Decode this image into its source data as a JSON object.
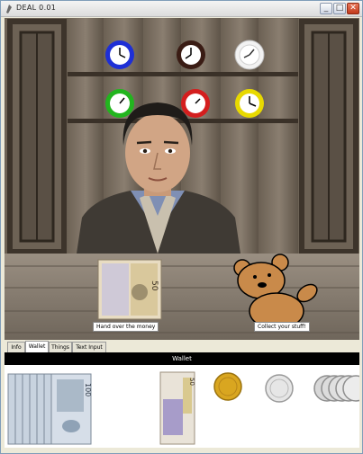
{
  "window": {
    "title": "DEAL 0.01"
  },
  "tabs": [
    {
      "label": "Info"
    },
    {
      "label": "Wallet"
    },
    {
      "label": "Things"
    },
    {
      "label": "Text Input"
    }
  ],
  "scene": {
    "hand_over_label": "Hand over the money",
    "collect_label": "Collect your stuff!",
    "banknote_value": "50"
  },
  "wallet": {
    "header": "Wallet",
    "note_value": "100",
    "small_note_value": "50"
  },
  "colors": {
    "clock_blue": "#1e2fd6",
    "clock_dark": "#3a1c14",
    "clock_white": "#f2f2f2",
    "clock_green": "#22b51e",
    "clock_red": "#d41e1e",
    "clock_yellow": "#e8d900",
    "bear": "#c98a4a",
    "wallet_header": "#000000"
  }
}
